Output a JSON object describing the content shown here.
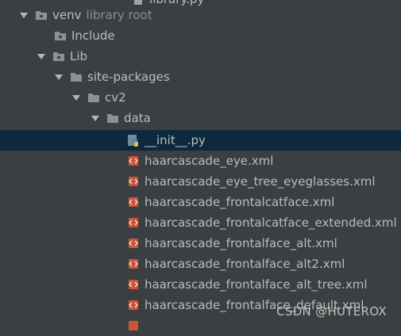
{
  "tree": {
    "cut_top_label": "library.py",
    "venv_label": "venv",
    "venv_hint": "library root",
    "include_label": "Include",
    "lib_label": "Lib",
    "site_packages_label": "site-packages",
    "cv2_label": "cv2",
    "data_label": "data",
    "files": [
      "__init__.py",
      "haarcascade_eye.xml",
      "haarcascade_eye_tree_eyeglasses.xml",
      "haarcascade_frontalcatface.xml",
      "haarcascade_frontalcatface_extended.xml",
      "haarcascade_frontalface_alt.xml",
      "haarcascade_frontalface_alt2.xml",
      "haarcascade_frontalface_alt_tree.xml",
      "haarcascade_frontalface_default.xml"
    ],
    "selected_file_index": 0
  },
  "watermark": "CSDN @HUTEROX",
  "colors": {
    "background": "#3c3f41",
    "selection": "#0d293e",
    "text": "#bbbbbb",
    "folder": "#8b9199",
    "xml_icon": "#d45b3a"
  }
}
